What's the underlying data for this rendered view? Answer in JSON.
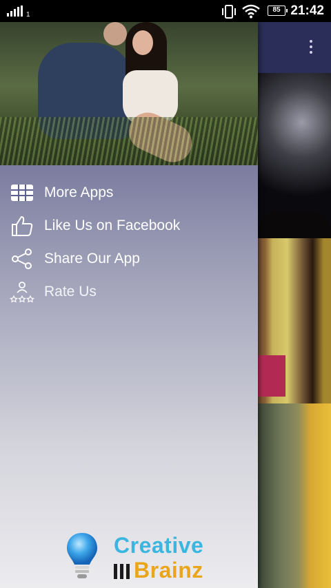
{
  "status_bar": {
    "sim_slot": "1",
    "battery": "85",
    "time": "21:42"
  },
  "drawer": {
    "menu": [
      {
        "label": "More Apps",
        "icon": "grid-icon"
      },
      {
        "label": "Like Us on Facebook",
        "icon": "thumbs-up-icon"
      },
      {
        "label": "Share Our App",
        "icon": "share-icon"
      },
      {
        "label": "Rate Us",
        "icon": "rate-stars-icon"
      }
    ],
    "brand": {
      "line1": "Creative",
      "line2": "Brainz",
      "colors": {
        "line1": "#3bb6e0",
        "line2": "#e9a51c"
      }
    }
  },
  "colors": {
    "drawer_top": "#4d5182",
    "drawer_bottom": "#ececef",
    "toolbar": "#2a2e58"
  }
}
